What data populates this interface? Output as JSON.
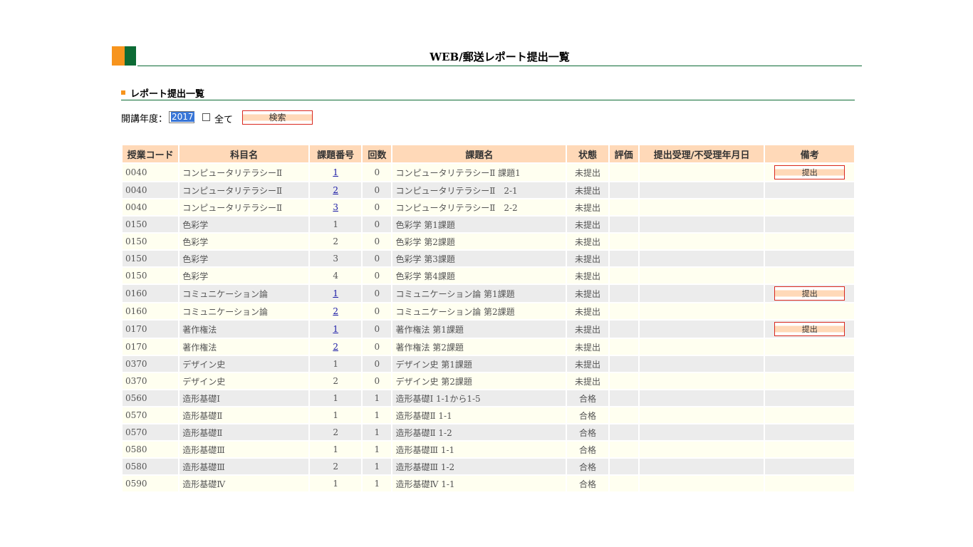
{
  "header": {
    "title": "WEB/郵送レポート提出一覧"
  },
  "section": {
    "title": "レポート提出一覧"
  },
  "filter": {
    "year_label": "開講年度：",
    "year_value": "2017",
    "all_label": "全て",
    "search_label": "検索"
  },
  "table": {
    "columns": [
      "授業コード",
      "科目名",
      "課題番号",
      "回数",
      "課題名",
      "状態",
      "評価",
      "提出受理/不受理年月日",
      "備考"
    ],
    "submit_label": "提出",
    "rows": [
      {
        "code": "0040",
        "subject": "コンピュータリテラシーⅡ",
        "no": "1",
        "link": true,
        "count": "0",
        "task": "コンピュータリテラシーⅡ 課題1",
        "status": "未提出",
        "grade": "",
        "date": "",
        "submit": true
      },
      {
        "code": "0040",
        "subject": "コンピュータリテラシーⅡ",
        "no": "2",
        "link": true,
        "count": "0",
        "task": "コンピュータリテラシーⅡ　2-1",
        "status": "未提出",
        "grade": "",
        "date": "",
        "submit": false
      },
      {
        "code": "0040",
        "subject": "コンピュータリテラシーⅡ",
        "no": "3",
        "link": true,
        "count": "0",
        "task": "コンピュータリテラシーⅡ　2-2",
        "status": "未提出",
        "grade": "",
        "date": "",
        "submit": false
      },
      {
        "code": "0150",
        "subject": "色彩学",
        "no": "1",
        "link": false,
        "count": "0",
        "task": "色彩学 第1課題",
        "status": "未提出",
        "grade": "",
        "date": "",
        "submit": false
      },
      {
        "code": "0150",
        "subject": "色彩学",
        "no": "2",
        "link": false,
        "count": "0",
        "task": "色彩学 第2課題",
        "status": "未提出",
        "grade": "",
        "date": "",
        "submit": false
      },
      {
        "code": "0150",
        "subject": "色彩学",
        "no": "3",
        "link": false,
        "count": "0",
        "task": "色彩学 第3課題",
        "status": "未提出",
        "grade": "",
        "date": "",
        "submit": false
      },
      {
        "code": "0150",
        "subject": "色彩学",
        "no": "4",
        "link": false,
        "count": "0",
        "task": "色彩学 第4課題",
        "status": "未提出",
        "grade": "",
        "date": "",
        "submit": false
      },
      {
        "code": "0160",
        "subject": "コミュニケーション論",
        "no": "1",
        "link": true,
        "count": "0",
        "task": "コミュニケーション論 第1課題",
        "status": "未提出",
        "grade": "",
        "date": "",
        "submit": true
      },
      {
        "code": "0160",
        "subject": "コミュニケーション論",
        "no": "2",
        "link": true,
        "count": "0",
        "task": "コミュニケーション論 第2課題",
        "status": "未提出",
        "grade": "",
        "date": "",
        "submit": false
      },
      {
        "code": "0170",
        "subject": "著作権法",
        "no": "1",
        "link": true,
        "count": "0",
        "task": "著作権法 第1課題",
        "status": "未提出",
        "grade": "",
        "date": "",
        "submit": true
      },
      {
        "code": "0170",
        "subject": "著作権法",
        "no": "2",
        "link": true,
        "count": "0",
        "task": "著作権法 第2課題",
        "status": "未提出",
        "grade": "",
        "date": "",
        "submit": false
      },
      {
        "code": "0370",
        "subject": "デザイン史",
        "no": "1",
        "link": false,
        "count": "0",
        "task": "デザイン史 第1課題",
        "status": "未提出",
        "grade": "",
        "date": "",
        "submit": false
      },
      {
        "code": "0370",
        "subject": "デザイン史",
        "no": "2",
        "link": false,
        "count": "0",
        "task": "デザイン史 第2課題",
        "status": "未提出",
        "grade": "",
        "date": "",
        "submit": false
      },
      {
        "code": "0560",
        "subject": "造形基礎Ⅰ",
        "no": "1",
        "link": false,
        "count": "1",
        "task": "造形基礎Ⅰ 1-1から1-5",
        "status": "合格",
        "grade": "",
        "date": "",
        "submit": false
      },
      {
        "code": "0570",
        "subject": "造形基礎Ⅱ",
        "no": "1",
        "link": false,
        "count": "1",
        "task": "造形基礎Ⅱ 1-1",
        "status": "合格",
        "grade": "",
        "date": "",
        "submit": false
      },
      {
        "code": "0570",
        "subject": "造形基礎Ⅱ",
        "no": "2",
        "link": false,
        "count": "1",
        "task": "造形基礎Ⅱ 1-2",
        "status": "合格",
        "grade": "",
        "date": "",
        "submit": false
      },
      {
        "code": "0580",
        "subject": "造形基礎Ⅲ",
        "no": "1",
        "link": false,
        "count": "1",
        "task": "造形基礎Ⅲ 1-1",
        "status": "合格",
        "grade": "",
        "date": "",
        "submit": false
      },
      {
        "code": "0580",
        "subject": "造形基礎Ⅲ",
        "no": "2",
        "link": false,
        "count": "1",
        "task": "造形基礎Ⅲ 1-2",
        "status": "合格",
        "grade": "",
        "date": "",
        "submit": false
      },
      {
        "code": "0590",
        "subject": "造形基礎Ⅳ",
        "no": "1",
        "link": false,
        "count": "1",
        "task": "造形基礎Ⅳ 1-1",
        "status": "合格",
        "grade": "",
        "date": "",
        "submit": false
      }
    ]
  },
  "colors": {
    "accent_orange": "#f7941d",
    "accent_green": "#0d6b35",
    "header_bg": "#ffd9b8",
    "button_border": "#d9281e"
  }
}
